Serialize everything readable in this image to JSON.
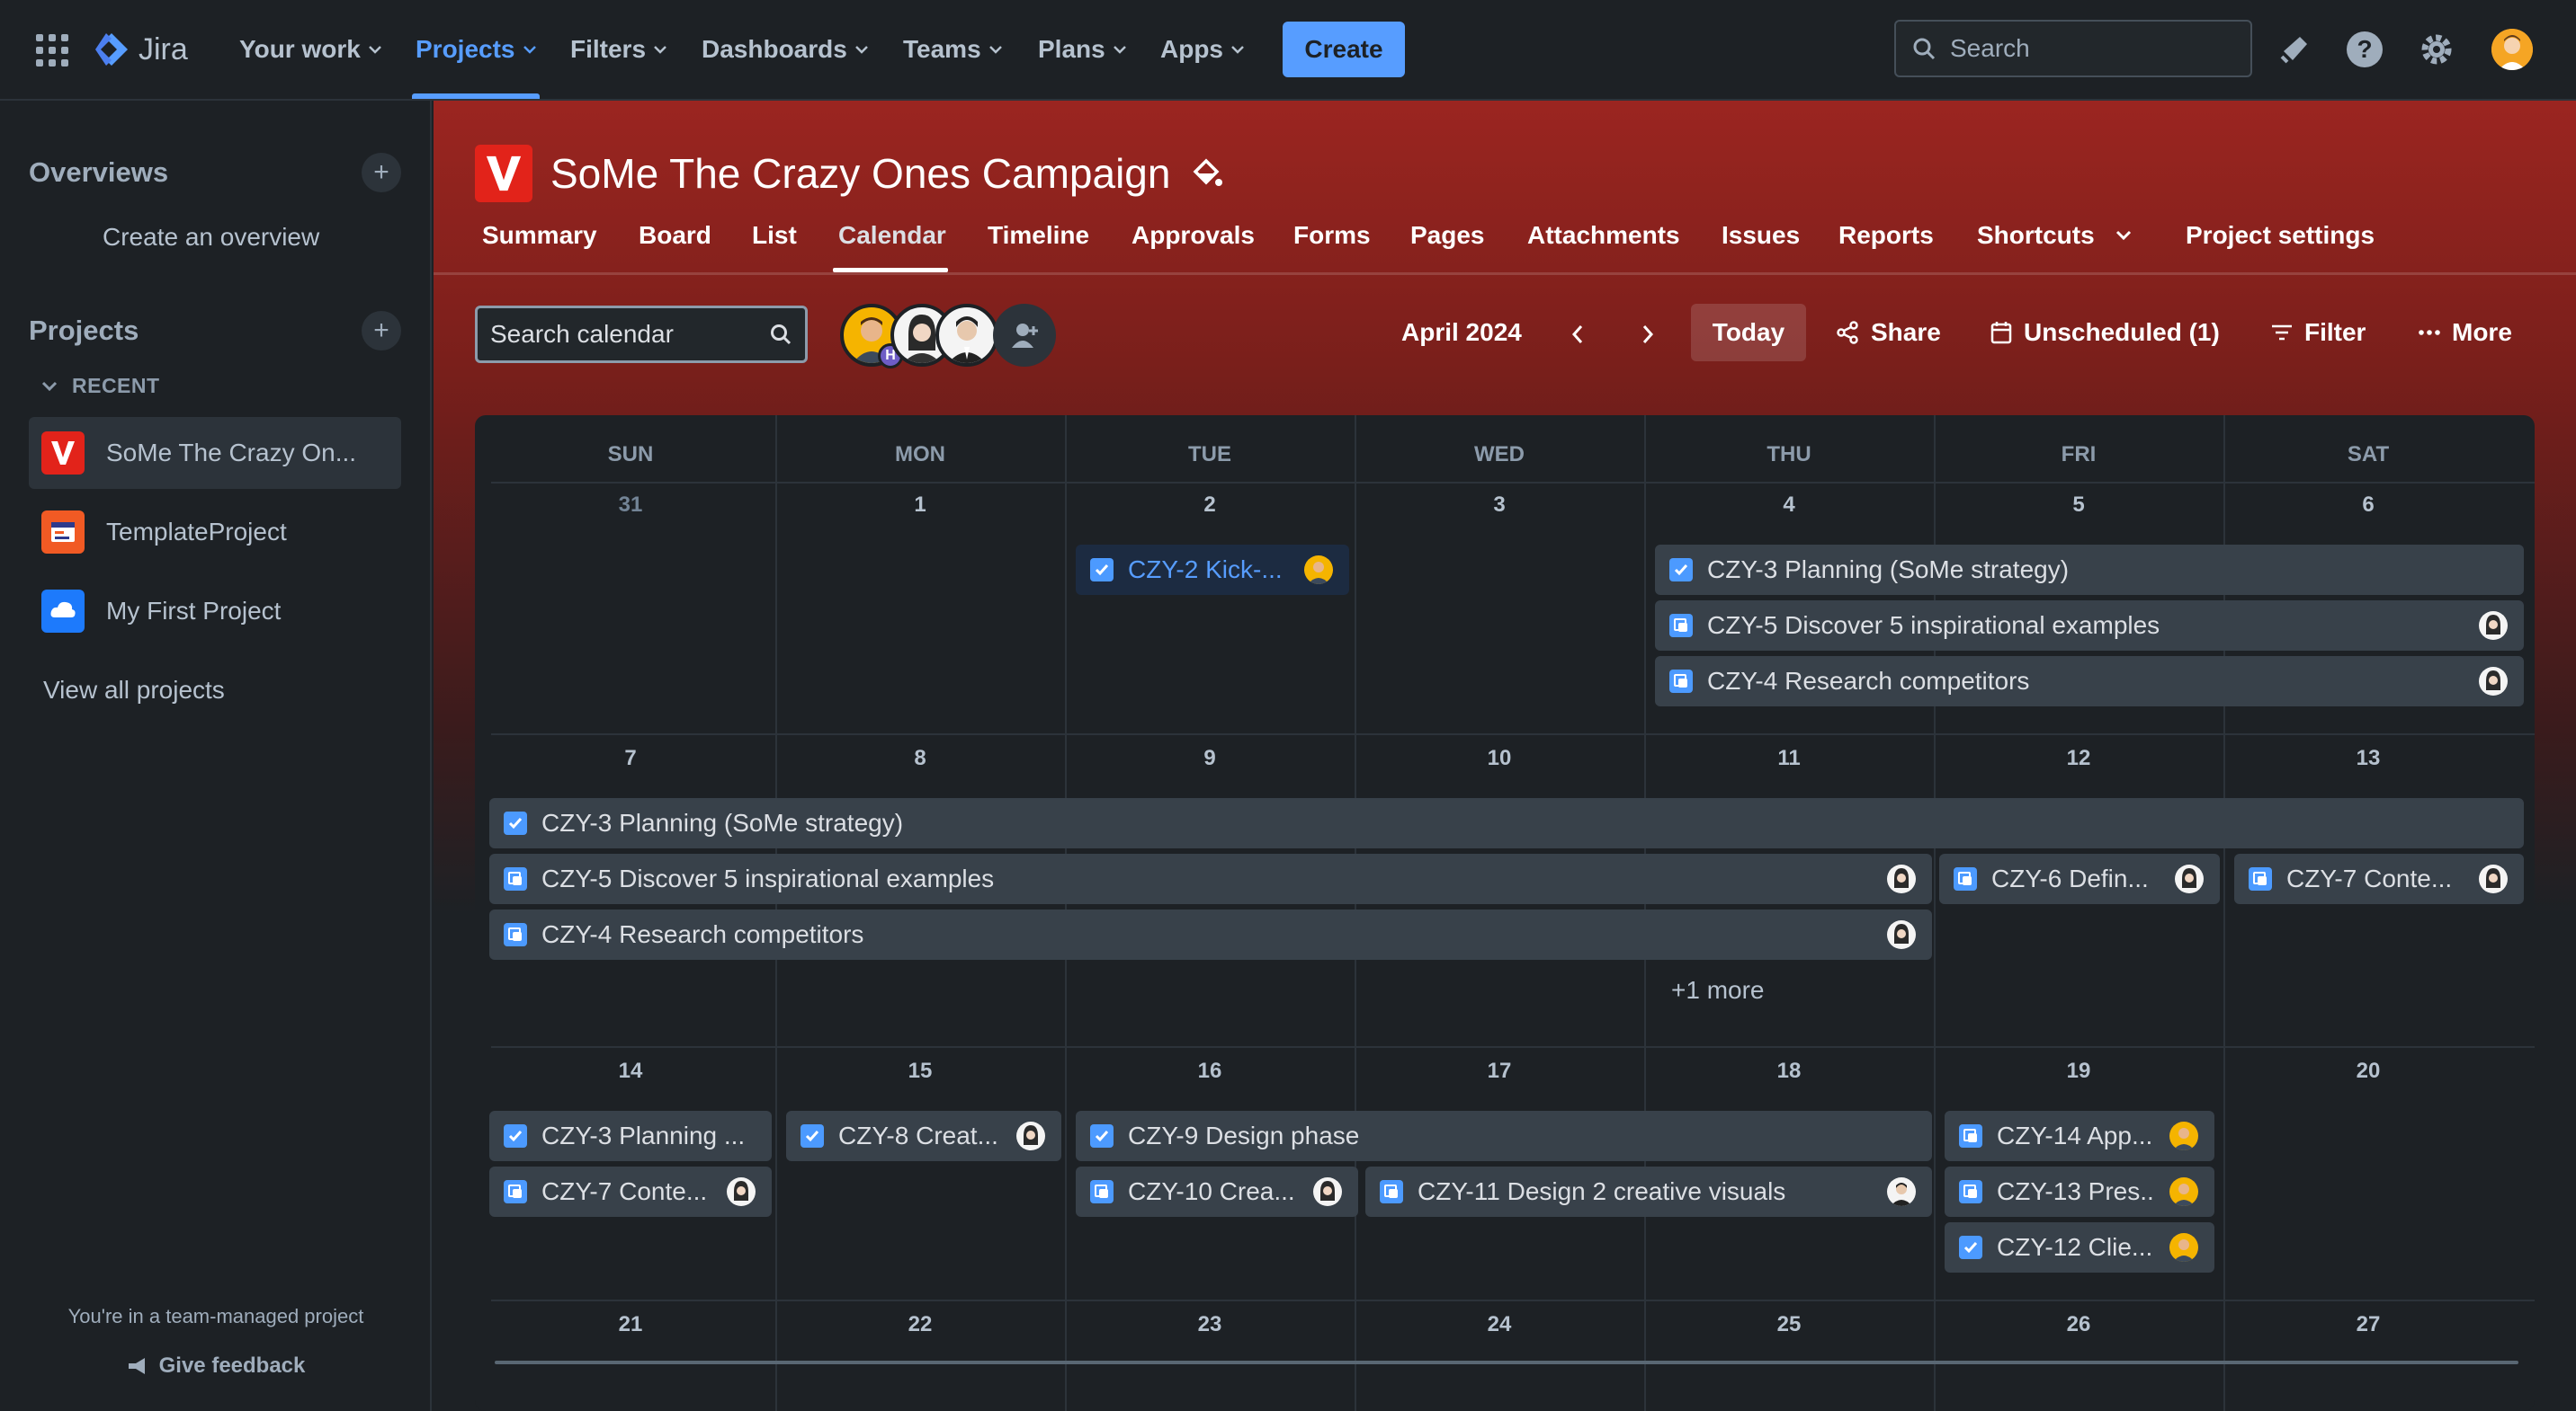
{
  "topnav": {
    "logo": "Jira",
    "items": [
      {
        "label": "Your work"
      },
      {
        "label": "Projects"
      },
      {
        "label": "Filters"
      },
      {
        "label": "Dashboards"
      },
      {
        "label": "Teams"
      },
      {
        "label": "Plans"
      },
      {
        "label": "Apps"
      }
    ],
    "create_label": "Create",
    "search_placeholder": "Search",
    "accent": "#579dff"
  },
  "sidebar": {
    "overviews_heading": "Overviews",
    "create_overview": "Create an overview",
    "projects_heading": "Projects",
    "recent_label": "RECENT",
    "projects": [
      {
        "name": "SoMe The Crazy On...",
        "icon": "v-logo-icon"
      },
      {
        "name": "TemplateProject",
        "icon": "template-project-icon"
      },
      {
        "name": "My First Project",
        "icon": "cloud-project-icon"
      }
    ],
    "view_all": "View all projects",
    "footer_text": "You're in a team-managed project",
    "feedback_label": "Give feedback"
  },
  "project": {
    "title": "SoMe The Crazy Ones Campaign",
    "tabs": [
      {
        "label": "Summary"
      },
      {
        "label": "Board"
      },
      {
        "label": "List"
      },
      {
        "label": "Calendar"
      },
      {
        "label": "Timeline"
      },
      {
        "label": "Approvals"
      },
      {
        "label": "Forms"
      },
      {
        "label": "Pages"
      },
      {
        "label": "Attachments"
      },
      {
        "label": "Issues"
      },
      {
        "label": "Reports"
      },
      {
        "label": "Shortcuts"
      },
      {
        "label": "Project settings"
      }
    ],
    "active_tab": "Calendar"
  },
  "toolbar": {
    "search_placeholder": "Search calendar",
    "avatar_badge": "H",
    "month": "April 2024",
    "today_label": "Today",
    "share_label": "Share",
    "unscheduled_label": "Unscheduled (1)",
    "filter_label": "Filter",
    "more_label": "More"
  },
  "calendar": {
    "weekdays": [
      "SUN",
      "MON",
      "TUE",
      "WED",
      "THU",
      "FRI",
      "SAT"
    ],
    "weeks": [
      [
        "31",
        "1",
        "2",
        "3",
        "4",
        "5",
        "6"
      ],
      [
        "7",
        "8",
        "9",
        "10",
        "11",
        "12",
        "13"
      ],
      [
        "14",
        "15",
        "16",
        "17",
        "18",
        "19",
        "20"
      ],
      [
        "21",
        "22",
        "23",
        "24",
        "25",
        "26",
        "27"
      ]
    ],
    "events": {
      "w1": [
        {
          "label": "CZY-2 Kick-...",
          "type": "task"
        },
        {
          "label": "CZY-3 Planning (SoMe strategy)",
          "type": "task"
        },
        {
          "label": "CZY-5 Discover 5 inspirational examples",
          "type": "subtask"
        },
        {
          "label": "CZY-4 Research competitors",
          "type": "subtask"
        }
      ],
      "w2": [
        {
          "label": "CZY-3 Planning (SoMe strategy)",
          "type": "task"
        },
        {
          "label": "CZY-5 Discover 5 inspirational examples",
          "type": "subtask"
        },
        {
          "label": "CZY-6 Defin...",
          "type": "subtask"
        },
        {
          "label": "CZY-7 Conte...",
          "type": "subtask"
        },
        {
          "label": "CZY-4 Research competitors",
          "type": "subtask"
        }
      ],
      "w2_more": "+1 more",
      "w3": [
        {
          "label": "CZY-3 Planning ...",
          "type": "task"
        },
        {
          "label": "CZY-8 Creat...",
          "type": "task"
        },
        {
          "label": "CZY-9 Design phase",
          "type": "task"
        },
        {
          "label": "CZY-14 App...",
          "type": "subtask"
        },
        {
          "label": "CZY-7 Conte...",
          "type": "subtask"
        },
        {
          "label": "CZY-10 Crea...",
          "type": "subtask"
        },
        {
          "label": "CZY-11 Design 2 creative visuals",
          "type": "subtask"
        },
        {
          "label": "CZY-13 Pres...",
          "type": "subtask"
        },
        {
          "label": "CZY-12 Clie...",
          "type": "task"
        }
      ]
    }
  }
}
